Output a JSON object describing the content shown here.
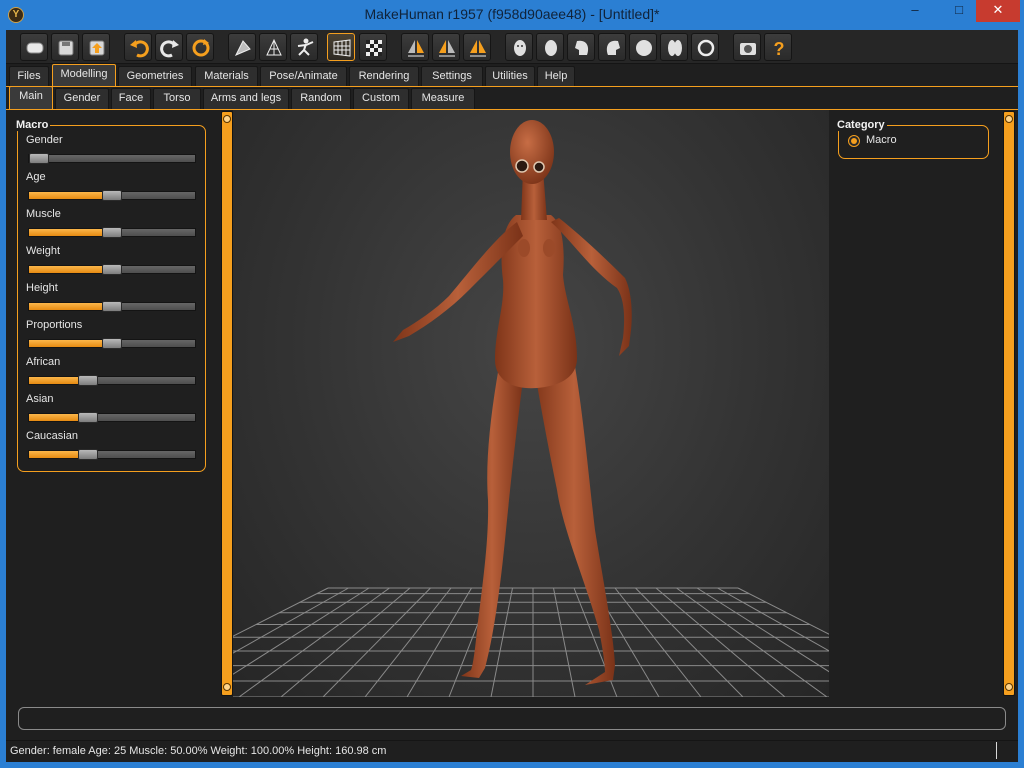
{
  "window": {
    "title": "MakeHuman r1957 (f958d90aee48) - [Untitled]*",
    "logo_glyph": "Y",
    "minimize_glyph": "–",
    "maximize_glyph": "□",
    "close_glyph": "✕"
  },
  "toolbar": {
    "icons": [
      "new-file-icon",
      "save-icon",
      "export-icon",
      "undo-icon",
      "redo-icon",
      "reset-icon",
      "smooth-icon",
      "wireframe-icon",
      "pose-icon",
      "grid-icon",
      "checkerboard-icon",
      "symmetry-right-icon",
      "symmetry-left-icon",
      "symmetry-icon",
      "front-view-icon",
      "back-view-icon",
      "left-view-icon",
      "right-view-icon",
      "top-view-icon",
      "bottom-view-icon",
      "reset-camera-icon",
      "screenshot-icon",
      "help-icon"
    ],
    "active": "grid-icon"
  },
  "main_tabs": [
    "Files",
    "Modelling",
    "Geometries",
    "Materials",
    "Pose/Animate",
    "Rendering",
    "Settings",
    "Utilities",
    "Help"
  ],
  "main_tab_active": "Modelling",
  "sub_tabs": [
    "Main",
    "Gender",
    "Face",
    "Torso",
    "Arms and legs",
    "Random",
    "Custom",
    "Measure"
  ],
  "sub_tab_active": "Main",
  "macro": {
    "title": "Macro",
    "sliders": [
      {
        "label": "Gender",
        "value": 0.0
      },
      {
        "label": "Age",
        "value": 0.5
      },
      {
        "label": "Muscle",
        "value": 0.5
      },
      {
        "label": "Weight",
        "value": 0.5
      },
      {
        "label": "Height",
        "value": 0.5
      },
      {
        "label": "Proportions",
        "value": 0.5
      },
      {
        "label": "African",
        "value": 0.333
      },
      {
        "label": "Asian",
        "value": 0.333
      },
      {
        "label": "Caucasian",
        "value": 0.333
      }
    ]
  },
  "category": {
    "title": "Category",
    "options": [
      "Macro"
    ],
    "selected": "Macro"
  },
  "status": {
    "text": "Gender: female Age: 25 Muscle: 50.00% Weight: 100.00% Height: 160.98 cm"
  },
  "colors": {
    "accent": "#f59f1e",
    "titlebar": "#2b7fd3",
    "skin": "#a8502d"
  }
}
